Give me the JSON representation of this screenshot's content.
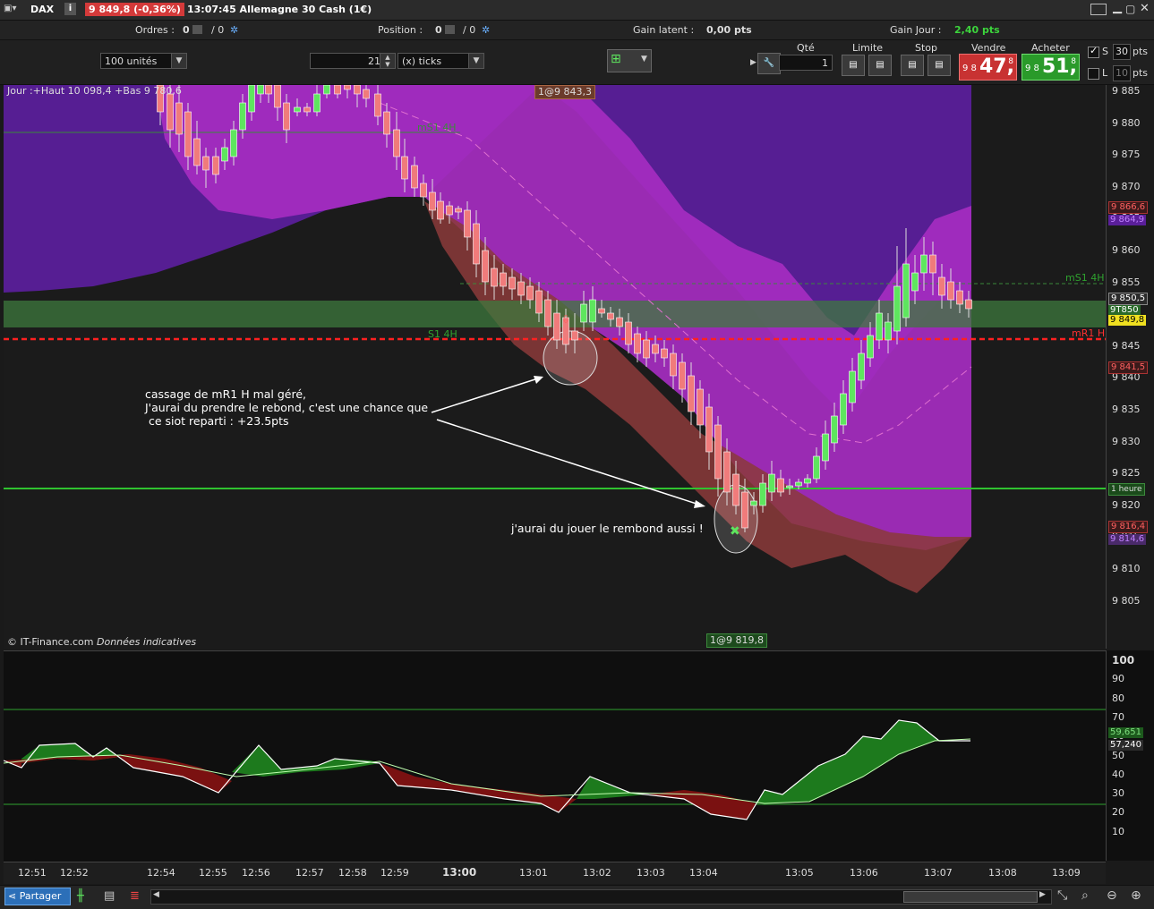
{
  "title_bar": {
    "instrument": "DAX",
    "info_icon": "i",
    "price_change": "9 849,8 (-0,36%)",
    "time_name": "13:07:45 Allemagne 30 Cash (1€)"
  },
  "orders_row": {
    "orders_label": "Ordres :",
    "orders_value": "0",
    "orders_sep": "/ 0",
    "position_label": "Position :",
    "position_value": "0",
    "position_sep": "/ 0",
    "gain_latent_label": "Gain latent :",
    "gain_latent_value": "0,00 pts",
    "gain_jour_label": "Gain Jour :",
    "gain_jour_value": "2,40 pts"
  },
  "toolbar": {
    "units_value": "100 unités",
    "ticks_value": "21",
    "ticks_unit": "(x) ticks",
    "qty_label": "Qté",
    "qty_value": "1",
    "limit_label": "Limite",
    "stop_label": "Stop",
    "sell_label": "Vendre",
    "buy_label": "Acheter",
    "sell_small": "9 8",
    "sell_big": "47,",
    "sell_sup": "8",
    "buy_small": "9 8",
    "buy_big": "51,",
    "buy_sup": "8",
    "s_label": "S",
    "s_value": "30",
    "s_unit": "pts",
    "l_label": "L",
    "l_value": "10",
    "l_unit": "pts"
  },
  "chart": {
    "header_text": "Jour :+Haut 10 098,4 +Bas 9 780,6",
    "top_tag": "1@9 843,3",
    "bottom_tag": "1@9 819,8",
    "copyright": "© IT-Finance.com",
    "copyright_italic": "Données indicatives",
    "level_labels": {
      "ms1_left": "mS1 4H",
      "ms1_right": "mS1 4H",
      "s1": "S1 4H",
      "mr1": "mR1 H",
      "one_hour": "1 heure"
    },
    "note1": "cassage de mR1 H mal géré,\nJ'aurai du prendre le rebond, c'est une chance que\n ce siot reparti : +23.5pts",
    "note2": "j'aurai du jouer le rembond aussi !"
  },
  "y_axis": {
    "ticks": [
      "9 885",
      "9 880",
      "9 875",
      "9 870",
      "9 865",
      "9 860",
      "9 855",
      "9 850",
      "9 845",
      "9 840",
      "9 835",
      "9 830",
      "9 825",
      "9 820",
      "9 815",
      "9 810",
      "9 805"
    ],
    "badges": {
      "b1": "9 866,6",
      "b2": "9 864,9",
      "b3": "9 850,5",
      "b4": "9T850",
      "b5": "9 849,8",
      "b6": "9 841,5",
      "b7": "1 heure",
      "b8": "9 816,4",
      "b9": "9 814,6"
    }
  },
  "osc_axis": {
    "ticks": [
      "100",
      "90",
      "80",
      "70",
      "60",
      "50",
      "40",
      "30",
      "20",
      "10"
    ],
    "badge1": "59,651",
    "badge2": "57,240"
  },
  "x_axis": {
    "ticks": [
      "12:51",
      "12:52",
      "12:54",
      "12:55",
      "12:56",
      "12:57",
      "12:58",
      "12:59",
      "13:00",
      "13:01",
      "13:02",
      "13:03",
      "13:04",
      "13:05",
      "13:06",
      "13:07",
      "13:08",
      "13:09"
    ]
  },
  "bottom_bar": {
    "share_label": "Partager"
  },
  "colors": {
    "candle_up": "#5ee65e",
    "candle_down": "#f07b7b",
    "band_purple": "#9b27b0",
    "band_dark_purple": "#5a1f9a",
    "band_red": "#8b3a3a",
    "level_green": "#2fc32f",
    "level_red": "#ff2020"
  }
}
